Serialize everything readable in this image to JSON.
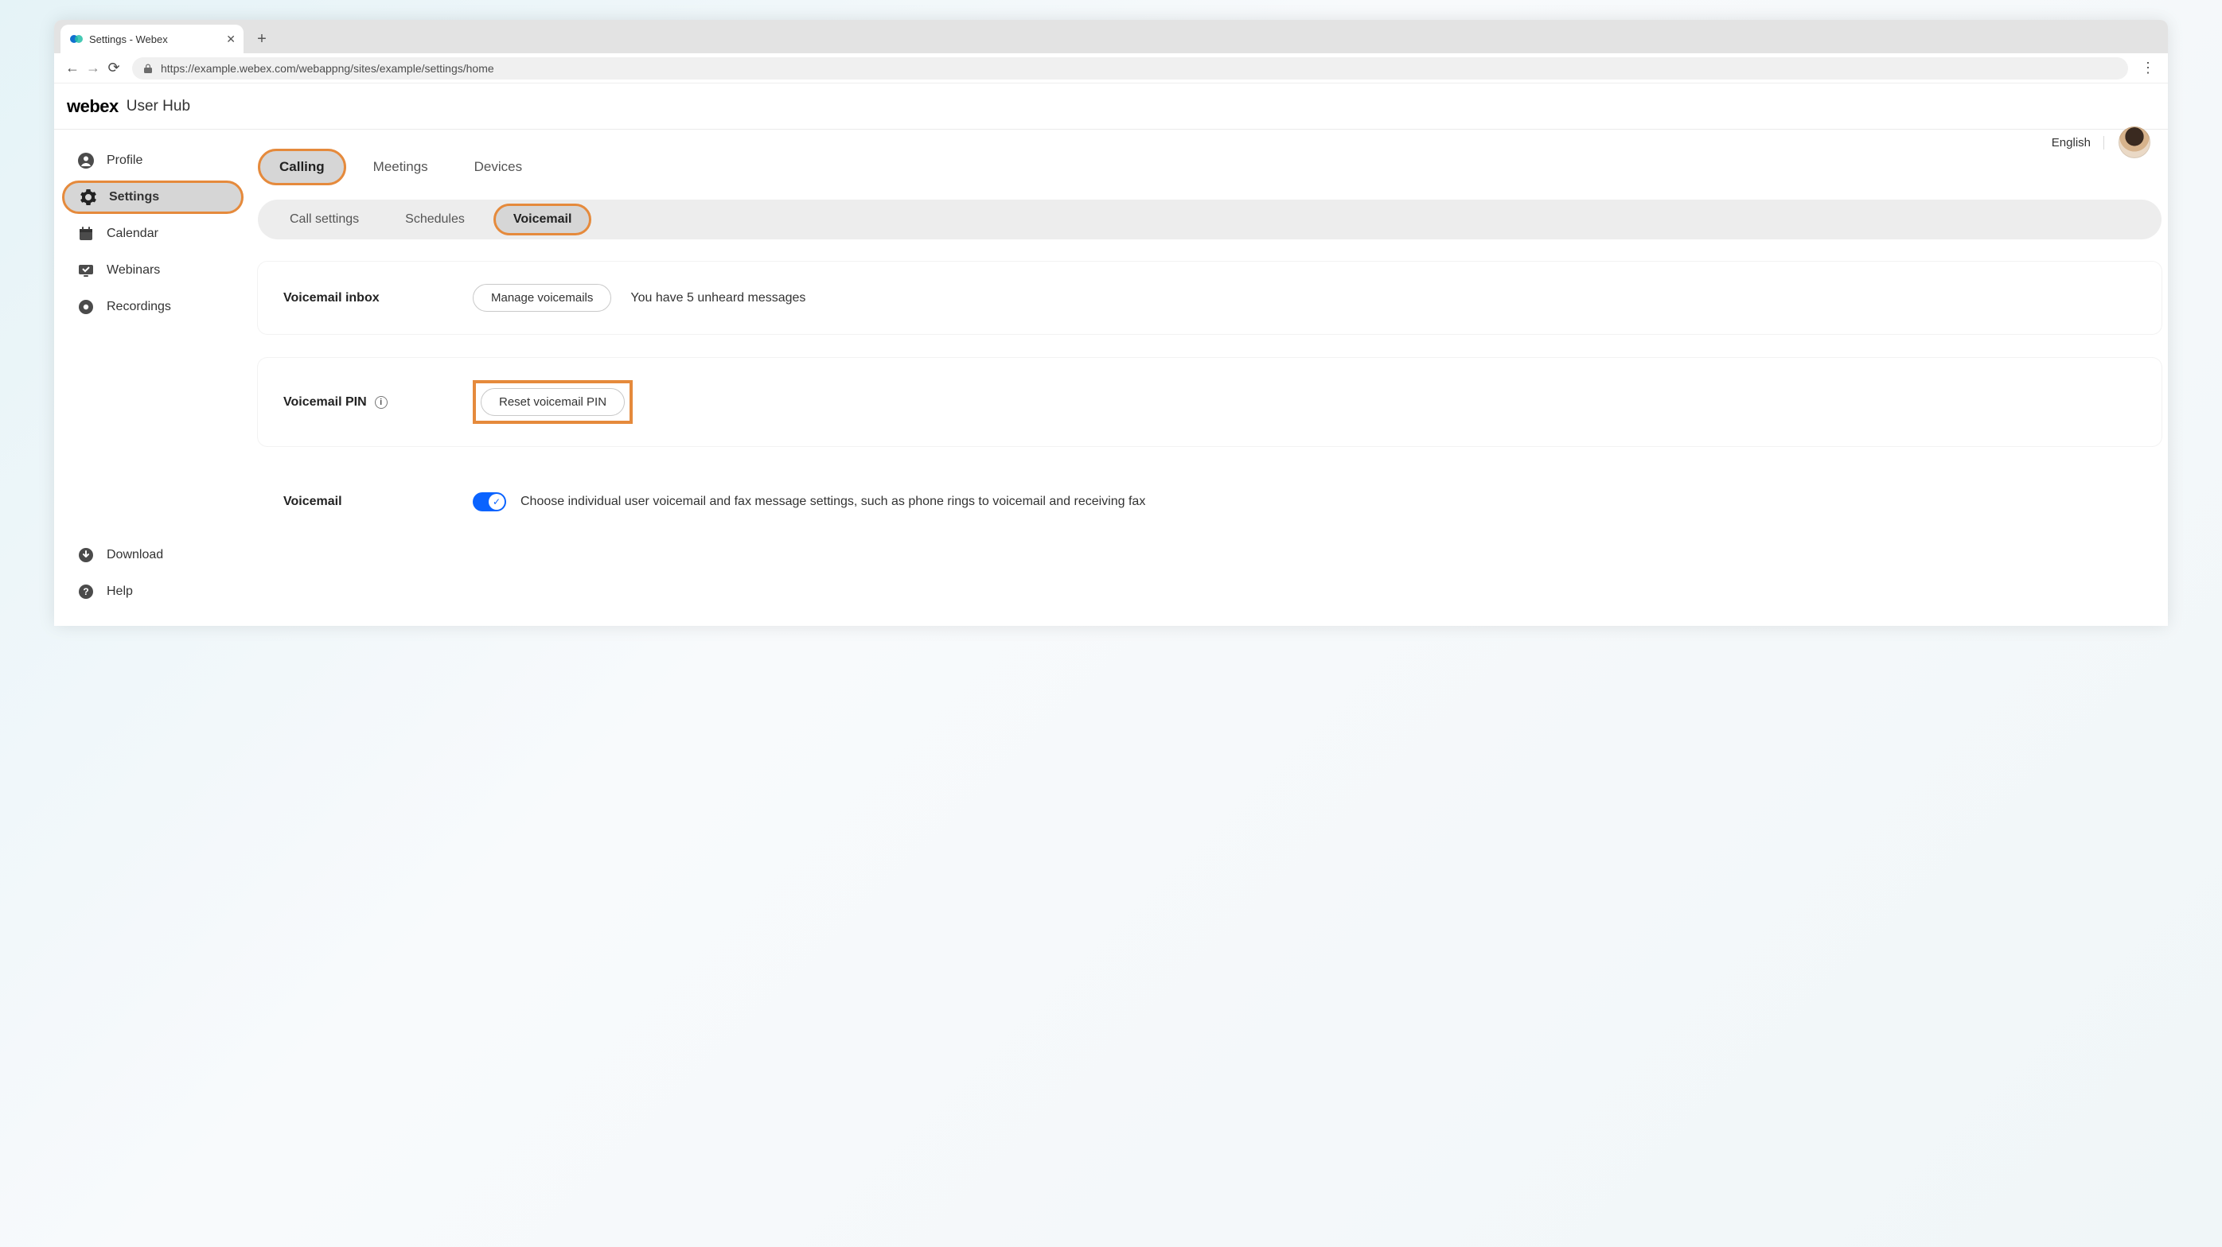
{
  "browser": {
    "tab_title": "Settings - Webex",
    "url": "https://example.webex.com/webappng/sites/example/settings/home"
  },
  "header": {
    "brand": "webex",
    "product": "User Hub",
    "language": "English"
  },
  "sidebar": {
    "items": [
      {
        "label": "Profile"
      },
      {
        "label": "Settings"
      },
      {
        "label": "Calendar"
      },
      {
        "label": "Webinars"
      },
      {
        "label": "Recordings"
      }
    ],
    "bottom": [
      {
        "label": "Download"
      },
      {
        "label": "Help"
      }
    ]
  },
  "tabs": {
    "primary": [
      {
        "label": "Calling"
      },
      {
        "label": "Meetings"
      },
      {
        "label": "Devices"
      }
    ],
    "secondary": [
      {
        "label": "Call settings"
      },
      {
        "label": "Schedules"
      },
      {
        "label": "Voicemail"
      }
    ]
  },
  "voicemail_inbox": {
    "title": "Voicemail inbox",
    "button": "Manage voicemails",
    "message": "You have 5 unheard messages"
  },
  "voicemail_pin": {
    "title": "Voicemail PIN",
    "button": "Reset voicemail PIN"
  },
  "voicemail_toggle": {
    "title": "Voicemail",
    "description": "Choose individual user voicemail and fax message settings, such as phone rings to voicemail and receiving fax"
  }
}
